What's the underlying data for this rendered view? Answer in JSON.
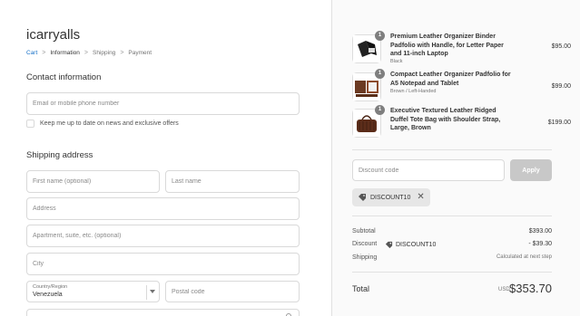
{
  "store": {
    "name": "icarryalls"
  },
  "breadcrumb": {
    "cart": "Cart",
    "information": "Information",
    "shipping": "Shipping",
    "payment": "Payment"
  },
  "contact": {
    "title": "Contact information",
    "email_placeholder": "Email or mobile phone number",
    "newsletter_label": "Keep me up to date on news and exclusive offers"
  },
  "shipping": {
    "title": "Shipping address",
    "first_name_placeholder": "First name (optional)",
    "last_name_placeholder": "Last name",
    "address_placeholder": "Address",
    "apartment_placeholder": "Apartment, suite, etc. (optional)",
    "city_placeholder": "City",
    "country_label": "Country/Region",
    "country_value": "Venezuela",
    "postal_placeholder": "Postal code"
  },
  "cart": {
    "items": [
      {
        "title": "Premium Leather Organizer Binder Padfolio with Handle, for Letter Paper and 11-inch Laptop",
        "variant": "Black",
        "price": "$95.00",
        "quantity": "1",
        "icon": "padfolio-black-image"
      },
      {
        "title": "Compact Leather Organizer Padfolio for A5 Notepad and Tablet",
        "variant": "Brown / Left-Handed",
        "price": "$99.00",
        "quantity": "1",
        "icon": "padfolio-brown-image"
      },
      {
        "title": "Executive Textured Leather Ridged Duffel Tote Bag with Shoulder Strap, Large, Brown",
        "variant": "",
        "price": "$199.00",
        "quantity": "1",
        "icon": "duffel-bag-image"
      }
    ],
    "discount_placeholder": "Discount code",
    "apply_label": "Apply",
    "applied_code": "DISCOUNT10"
  },
  "summary": {
    "subtotal_label": "Subtotal",
    "subtotal_value": "$393.00",
    "discount_label": "Discount",
    "discount_code": "DISCOUNT10",
    "discount_value": "- $39.30",
    "shipping_label": "Shipping",
    "shipping_value": "Calculated at next step",
    "total_label": "Total",
    "total_currency": "USD",
    "total_value": "$353.70"
  },
  "colors": {
    "link": "#1a73c9",
    "apply_disabled": "#c8c8c8",
    "sidebar_bg": "#fafafa",
    "badge": "#7f7f7f"
  }
}
